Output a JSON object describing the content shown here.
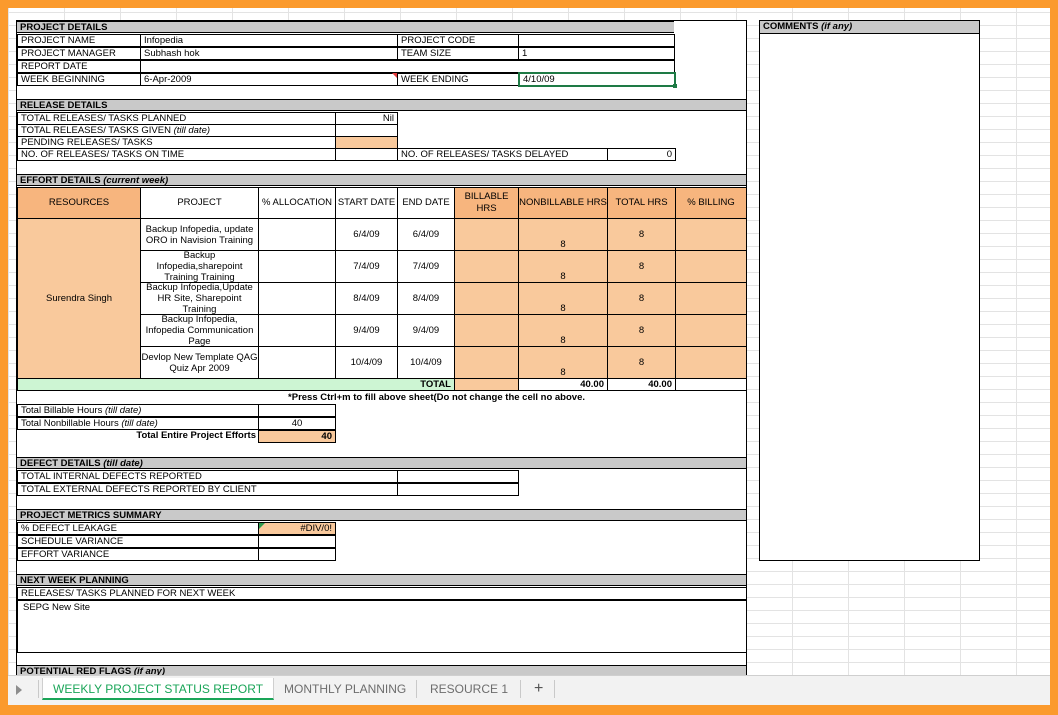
{
  "project": {
    "title": "PROJECT DETAILS",
    "name_label": "PROJECT NAME",
    "name_value": "Infopedia",
    "manager_label": "PROJECT MANAGER",
    "manager_value": "Subhash hok",
    "report_label": "REPORT DATE",
    "week_begin_label": "WEEK BEGINNING",
    "week_begin_value": "6-Apr-2009",
    "code_label": "PROJECT CODE",
    "team_label": "TEAM SIZE",
    "team_value": "1",
    "week_end_label": "WEEK ENDING",
    "week_end_value": "4/10/09"
  },
  "release": {
    "title": "RELEASE DETAILS",
    "planned_label": "TOTAL RELEASES/ TASKS PLANNED",
    "planned_value": "Nil",
    "given_label": "TOTAL RELEASES/ TASKS GIVEN",
    "given_note": "(till date)",
    "pending_label": "PENDING RELEASES/ TASKS",
    "ontime_label": "NO. OF RELEASES/ TASKS ON TIME",
    "delayed_label": "NO. OF RELEASES/ TASKS DELAYED",
    "delayed_value": "0"
  },
  "effort": {
    "title": "EFFORT DETAILS",
    "title_note": "(current week)",
    "headers": [
      "RESOURCES",
      "PROJECT",
      "% ALLOCATION",
      "START DATE",
      "END DATE",
      "BILLABLE HRS",
      "NONBILLABLE HRS",
      "TOTAL HRS",
      "% BILLING"
    ],
    "resource": "Surendra Singh",
    "rows": [
      {
        "project": "Backup Infopedia, update ORO in Navision Training",
        "start": "6/4/09",
        "end": "6/4/09",
        "nonbillable": "8",
        "total": "8"
      },
      {
        "project": "Backup Infopedia,sharepoint Training Training",
        "start": "7/4/09",
        "end": "7/4/09",
        "nonbillable": "8",
        "total": "8"
      },
      {
        "project": "Backup Infopedia,Update HR Site, Sharepoint Training",
        "start": "8/4/09",
        "end": "8/4/09",
        "nonbillable": "8",
        "total": "8"
      },
      {
        "project": "Backup Infopedia, Infopedia Communication Page",
        "start": "9/4/09",
        "end": "9/4/09",
        "nonbillable": "8",
        "total": "8"
      },
      {
        "project": "Devlop New Template QAG Quiz Apr 2009",
        "start": "10/4/09",
        "end": "10/4/09",
        "nonbillable": "8",
        "total": "8"
      }
    ],
    "total_label": "TOTAL",
    "total_nonbillable": "40.00",
    "total_hrs": "40.00",
    "note": "*Press Ctrl+m to fill above sheet(Do not change the cell no above.",
    "billable_till_label": "Total Billable Hours",
    "till_note": "(till date)",
    "nonbillable_till_label": "Total Nonbillable Hours",
    "nonbillable_till_value": "40",
    "entire_label": "Total Entire Project Efforts",
    "entire_value": "40"
  },
  "defects": {
    "title": "DEFECT DETAILS",
    "title_note": "(till date)",
    "internal_label": "TOTAL INTERNAL DEFECTS REPORTED",
    "external_label": "TOTAL EXTERNAL DEFECTS REPORTED BY CLIENT"
  },
  "metrics": {
    "title": "PROJECT METRICS SUMMARY",
    "leakage_label": "% DEFECT LEAKAGE",
    "leakage_value": "#DIV/0!",
    "schedule_label": "SCHEDULE VARIANCE",
    "effort_label": "EFFORT VARIANCE"
  },
  "next_week": {
    "title": "NEXT WEEK PLANNING",
    "planned_label": "RELEASES/ TASKS PLANNED FOR NEXT WEEK",
    "planned_value": "SEPG New Site"
  },
  "red_flags": {
    "title": "POTENTIAL RED FLAGS",
    "title_note": "(if any)"
  },
  "comments": {
    "title": "COMMENTS",
    "title_note": "(if any)"
  },
  "tabs": [
    "WEEKLY PROJECT STATUS REPORT",
    "MONTHLY PLANNING",
    "RESOURCE 1"
  ],
  "add_tab_symbol": "+",
  "colors": {
    "peach": "#f9c99c",
    "header_orange": "#f7b57e",
    "green_total": "#cdf5d3",
    "tab_active": "#1aa558",
    "frame": "#fb9a2d"
  }
}
